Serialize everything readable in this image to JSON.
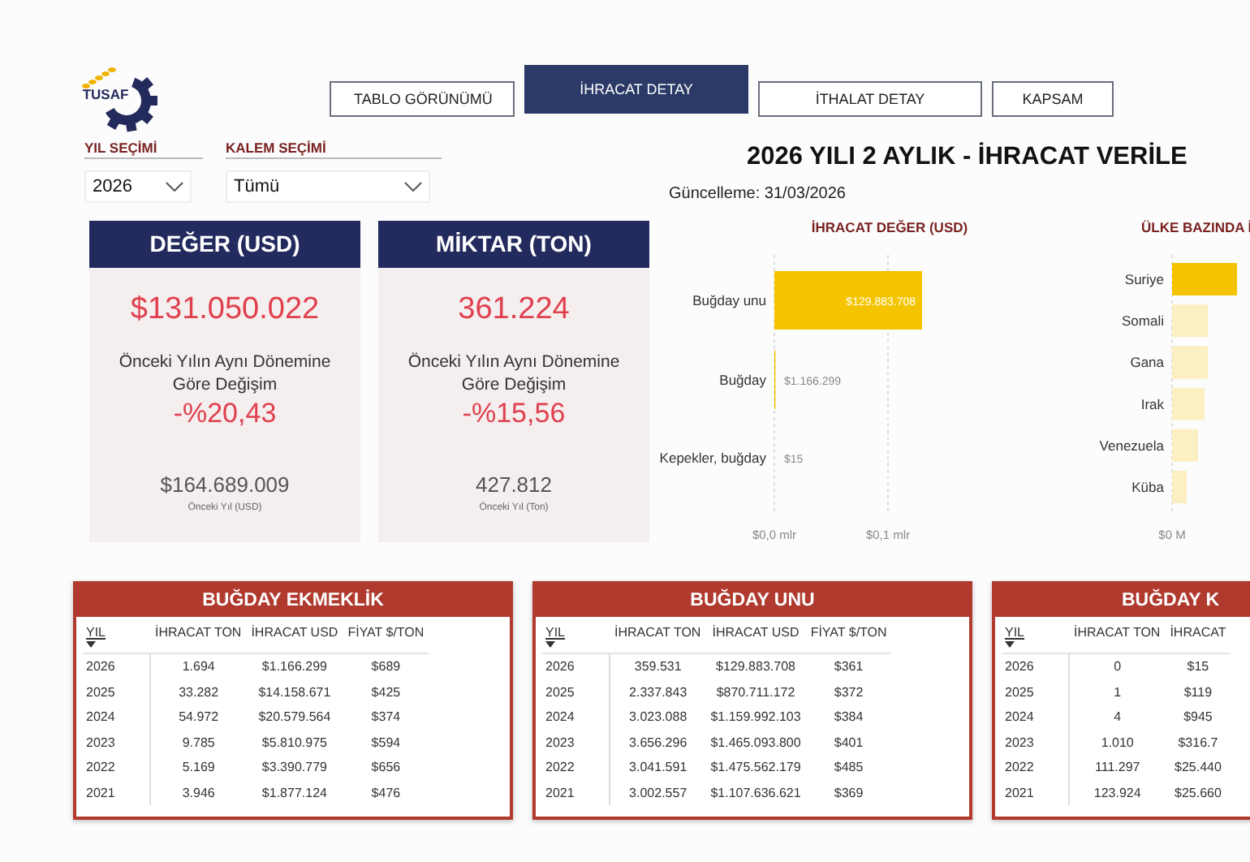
{
  "logo": {
    "text": "TUSAF"
  },
  "nav_tabs": [
    {
      "label": "TABLO GÖRÜNÜMÜ",
      "selected": false
    },
    {
      "label": "İHRACAT DETAY",
      "selected": true
    },
    {
      "label": "İTHALAT DETAY",
      "selected": false
    },
    {
      "label": "KAPSAM",
      "selected": false
    }
  ],
  "filters": [
    {
      "label": "YIL SEÇİMİ",
      "value": "2026"
    },
    {
      "label": "KALEM SEÇİMİ",
      "value": "Tümü"
    }
  ],
  "title": "2026 YILI 2 AYLIK - İHRACAT VERİLE",
  "updated": "Güncelleme: 31/03/2026",
  "kpi_cards": [
    {
      "title": "DEĞER (USD)",
      "value": "$131.050.022",
      "change_label": "Önceki Yılın Aynı Dönemine Göre Değişim",
      "change": "-%20,43",
      "previous_value": "$164.689.009",
      "previous_label": "Önceki Yıl (USD)"
    },
    {
      "title": "MİKTAR (TON)",
      "value": "361.224",
      "change_label": "Önceki Yılın Aynı Dönemine Göre Değişim",
      "change": "-%15,56",
      "previous_value": "427.812",
      "previous_label": "Önceki Yıl (Ton)"
    }
  ],
  "value_chart": {
    "title": "İHRACAT DEĞER (USD)",
    "chart_data": {
      "type": "bar",
      "orientation": "horizontal",
      "categories": [
        "Buğday unu",
        "Buğday",
        "Kepekler, buğday"
      ],
      "series": [
        {
          "color": "#f5c400",
          "values": [
            0.13,
            0.001,
            0
          ]
        }
      ],
      "value_labels": [
        "$129.883.708",
        "$1.166.299",
        "$15"
      ],
      "xlim": [
        0,
        0.13
      ],
      "xticks": [
        {
          "value": 0,
          "label": "$0,0 mlr"
        },
        {
          "value": 0.1,
          "label": "$0,1 mlr"
        }
      ]
    }
  },
  "country_chart": {
    "title": "ÜLKE BAZINDA İ",
    "countries": [
      "Suriye",
      "Somali",
      "Gana",
      "Irak",
      "Venezuela",
      "Küba"
    ],
    "axis_label": "$0 M"
  },
  "tables": [
    {
      "title": "BUĞDAY EKMEKLİK",
      "columns": [
        "YIL",
        "İHRACAT TON",
        "İHRACAT USD",
        "FİYAT $/TON"
      ],
      "rows": [
        [
          "2026",
          "1.694",
          "$1.166.299",
          "$689"
        ],
        [
          "2025",
          "33.282",
          "$14.158.671",
          "$425"
        ],
        [
          "2024",
          "54.972",
          "$20.579.564",
          "$374"
        ],
        [
          "2023",
          "9.785",
          "$5.810.975",
          "$594"
        ],
        [
          "2022",
          "5.169",
          "$3.390.779",
          "$656"
        ],
        [
          "2021",
          "3.946",
          "$1.877.124",
          "$476"
        ]
      ]
    },
    {
      "title": "BUĞDAY UNU",
      "columns": [
        "YIL",
        "İHRACAT TON",
        "İHRACAT USD",
        "FİYAT $/TON"
      ],
      "rows": [
        [
          "2026",
          "359.531",
          "$129.883.708",
          "$361"
        ],
        [
          "2025",
          "2.337.843",
          "$870.711.172",
          "$372"
        ],
        [
          "2024",
          "3.023.088",
          "$1.159.992.103",
          "$384"
        ],
        [
          "2023",
          "3.656.296",
          "$1.465.093.800",
          "$401"
        ],
        [
          "2022",
          "3.041.591",
          "$1.475.562.179",
          "$485"
        ],
        [
          "2021",
          "3.002.557",
          "$1.107.636.621",
          "$369"
        ]
      ]
    },
    {
      "title": "BUĞDAY K",
      "columns": [
        "YIL",
        "İHRACAT TON",
        "İHRACAT"
      ],
      "rows": [
        [
          "2026",
          "0",
          "$15"
        ],
        [
          "2025",
          "1",
          "$119"
        ],
        [
          "2024",
          "4",
          "$945"
        ],
        [
          "2023",
          "1.010",
          "$316.7"
        ],
        [
          "2022",
          "111.297",
          "$25.440"
        ],
        [
          "2021",
          "123.924",
          "$25.660"
        ]
      ]
    }
  ]
}
